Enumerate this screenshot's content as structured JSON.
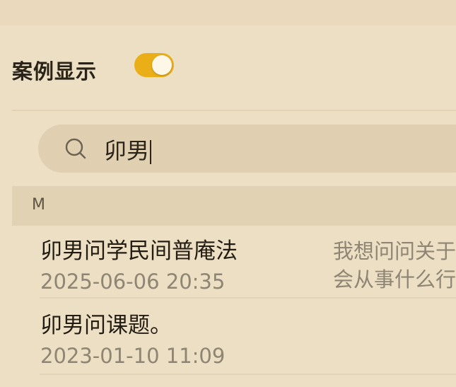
{
  "settings": {
    "case_display_label": "案例显示",
    "case_display_enabled": true
  },
  "colors": {
    "toggle_on": "#eaae19",
    "background": "#ecdfc4",
    "search_bg": "#e0cfb1"
  },
  "search": {
    "icon": "search-icon",
    "query": "卯男"
  },
  "section": {
    "letter": "M"
  },
  "items": [
    {
      "title": "卯男问学民间普庵法",
      "date": "2025-06-06 20:35",
      "preview": "我想问问关于\n会从事什么行"
    },
    {
      "title": "卯男问课题。",
      "date": "2023-01-10 11:09",
      "preview": ""
    }
  ]
}
